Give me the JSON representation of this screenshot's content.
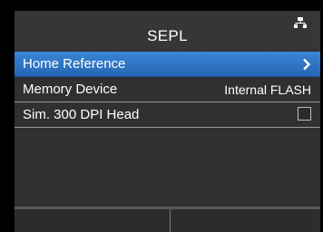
{
  "header": {
    "title": "SEPL",
    "status_icon": "network-icon"
  },
  "menu": {
    "items": [
      {
        "label": "Home Reference",
        "value": "",
        "control": "chevron-right-icon",
        "selected": true
      },
      {
        "label": "Memory Device",
        "value": "Internal FLASH",
        "control": "",
        "selected": false
      },
      {
        "label": "Sim. 300 DPI Head",
        "value": "",
        "control": "checkbox",
        "checked": false,
        "selected": false
      }
    ]
  },
  "colors": {
    "background": "#303030",
    "selection": "#2f78c8",
    "text": "#ffffff",
    "divider": "#9a9a9a"
  }
}
